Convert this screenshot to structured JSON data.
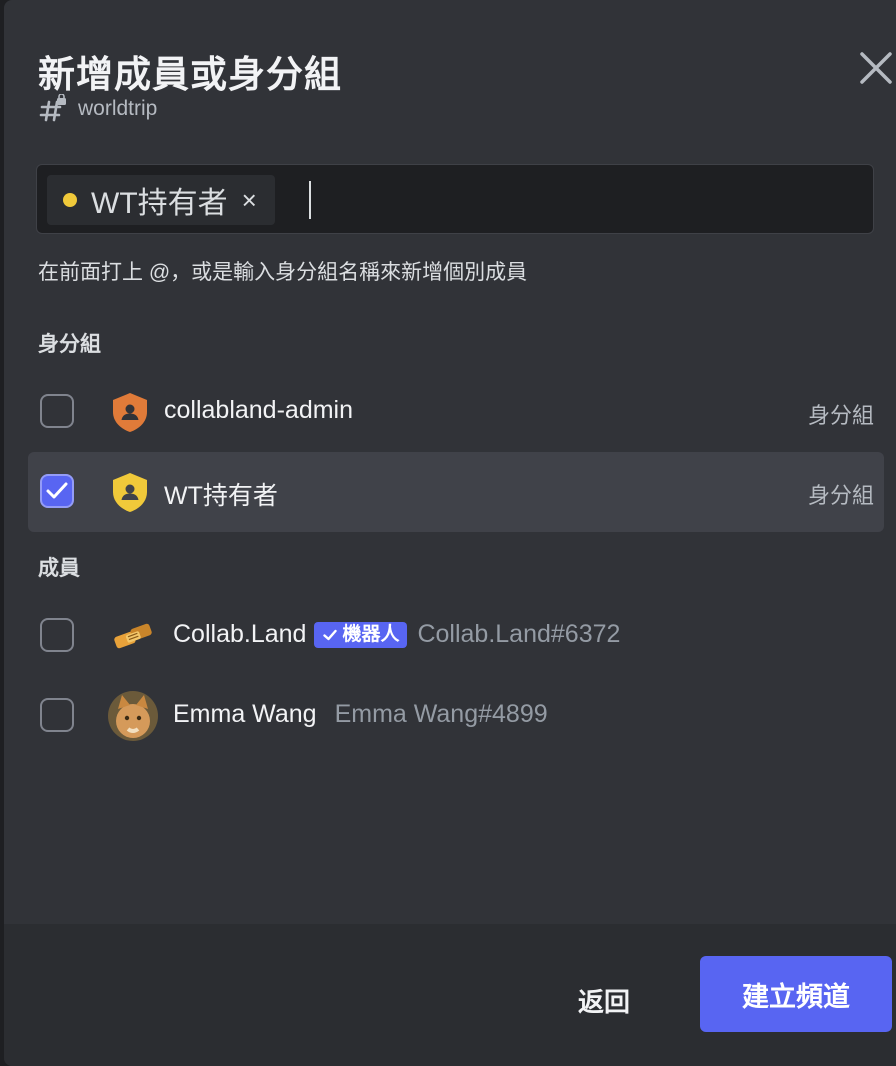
{
  "modal": {
    "title": "新增成員或身分組",
    "channel_name": "worldtrip"
  },
  "input": {
    "chip_label": "WT持有者",
    "chip_remove": "×",
    "hint": "在前面打上 @，或是輸入身分組名稱來新增個別成員"
  },
  "roles_section": {
    "label": "身分組",
    "items": [
      {
        "name": "collabland-admin",
        "type": "身分組",
        "checked": false,
        "color": "#e07b39"
      },
      {
        "name": "WT持有者",
        "type": "身分組",
        "checked": true,
        "color": "#f0c93a"
      }
    ]
  },
  "members_section": {
    "label": "成員",
    "items": [
      {
        "name": "Collab.Land",
        "bot_tag": "機器人",
        "tag": "Collab.Land#6372",
        "checked": false
      },
      {
        "name": "Emma Wang",
        "tag": "Emma Wang#4899",
        "checked": false
      }
    ]
  },
  "footer": {
    "back_label": "返回",
    "create_label": "建立頻道"
  },
  "colors": {
    "accent": "#5865f2",
    "background": "#313338",
    "footer": "#2b2d31"
  },
  "icons": {
    "close": "close-icon",
    "private_channel": "hashtag-lock-icon",
    "role": "role-shield-icon",
    "check": "check-icon"
  }
}
